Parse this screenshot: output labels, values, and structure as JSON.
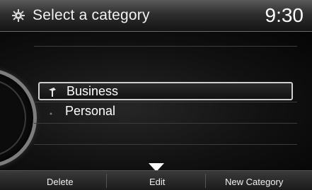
{
  "header": {
    "icon": "gear-icon",
    "title": "Select a category",
    "clock": "9:30"
  },
  "list": {
    "items": [
      {
        "label": "Business",
        "icon": "pin-icon",
        "selected": true
      },
      {
        "label": "Personal",
        "icon": "dot-icon",
        "selected": false
      }
    ]
  },
  "footer": {
    "delete_label": "Delete",
    "edit_label": "Edit",
    "new_category_label": "New Category"
  },
  "colors": {
    "text": "#ffffff",
    "highlight_border": "#cfcfcf",
    "background": "#000000"
  }
}
